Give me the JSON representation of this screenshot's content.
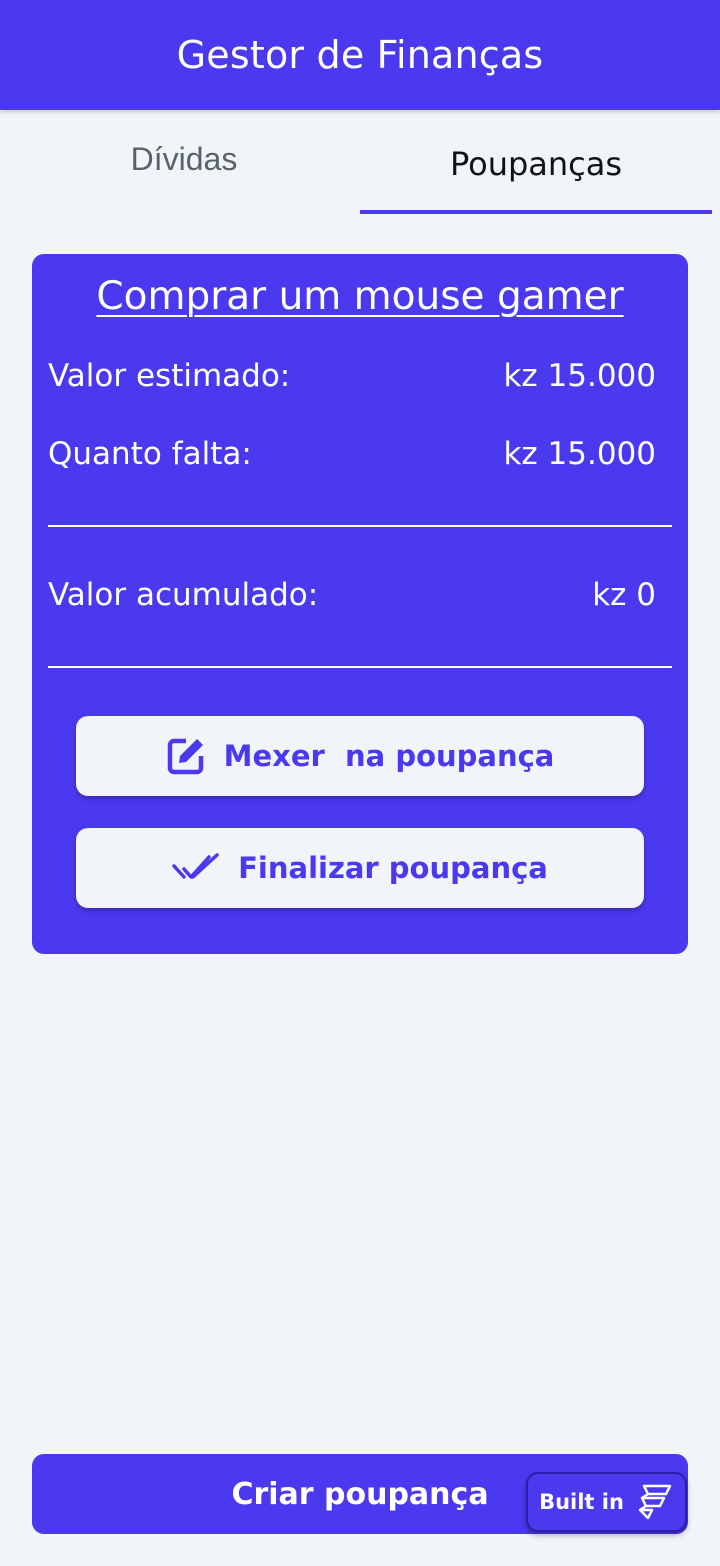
{
  "app_bar": {
    "title": "Gestor de Finanças"
  },
  "tabs": [
    {
      "label": "Dívidas",
      "selected": false
    },
    {
      "label": "Poupanças",
      "selected": true
    }
  ],
  "saving_card": {
    "title": "Comprar um mouse gamer",
    "valor_estimado_label": "Valor estimado:",
    "valor_estimado_value": "kz 15.000",
    "quanto_falta_label": "Quanto falta:",
    "quanto_falta_value": "kz 15.000",
    "valor_acumulado_label": "Valor acumulado:",
    "valor_acumulado_value": "kz 0",
    "edit_button_label": "Mexer  na poupança",
    "edit_button_icon": "edit-icon",
    "finish_button_label": "Finalizar poupança",
    "finish_button_icon": "double-check-icon"
  },
  "create_button": {
    "label": "Criar poupança"
  },
  "built_badge": {
    "label": "Built in",
    "icon": "flutterflow-logo-icon"
  },
  "colors": {
    "primary": "#4B39EF",
    "background": "#F1F4F8",
    "button_bg": "#F1F4F8",
    "text_on_primary": "#FFFFFF",
    "tab_unselected": "#57636C",
    "tab_selected": "#101213"
  }
}
